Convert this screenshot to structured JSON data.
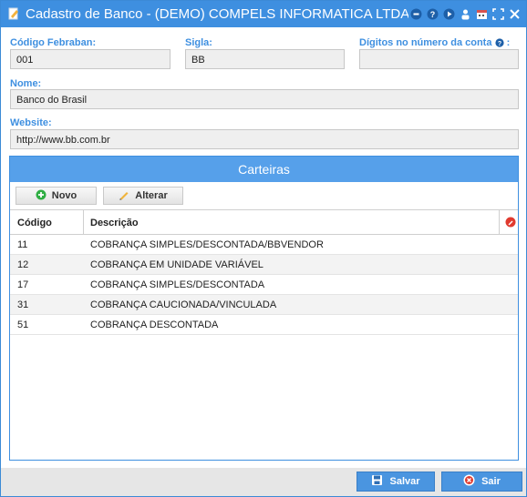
{
  "window": {
    "title": "Cadastro de Banco - (DEMO) COMPELS INFORMATICA LTDA - M..."
  },
  "form": {
    "codigo_label": "Código Febraban:",
    "codigo_value": "001",
    "sigla_label": "Sigla:",
    "sigla_value": "BB",
    "digitos_label": "Dígitos no número da conta",
    "digitos_suffix": ":",
    "digitos_value": "",
    "nome_label": "Nome:",
    "nome_value": "Banco do Brasil",
    "website_label": "Website:",
    "website_value": "http://www.bb.com.br"
  },
  "carteiras": {
    "title": "Carteiras",
    "novo_label": "Novo",
    "alterar_label": "Alterar",
    "col_codigo": "Código",
    "col_descricao": "Descrição",
    "rows": [
      {
        "codigo": "11",
        "descricao": "COBRANÇA SIMPLES/DESCONTADA/BBVENDOR"
      },
      {
        "codigo": "12",
        "descricao": "COBRANÇA EM UNIDADE VARIÁVEL"
      },
      {
        "codigo": "17",
        "descricao": "COBRANÇA SIMPLES/DESCONTADA"
      },
      {
        "codigo": "31",
        "descricao": "COBRANÇA CAUCIONADA/VINCULADA"
      },
      {
        "codigo": "51",
        "descricao": "COBRANÇA DESCONTADA"
      }
    ]
  },
  "footer": {
    "salvar_label": "Salvar",
    "sair_label": "Sair"
  },
  "colors": {
    "accent": "#3e8fe0",
    "panel_header": "#56a0ea"
  }
}
